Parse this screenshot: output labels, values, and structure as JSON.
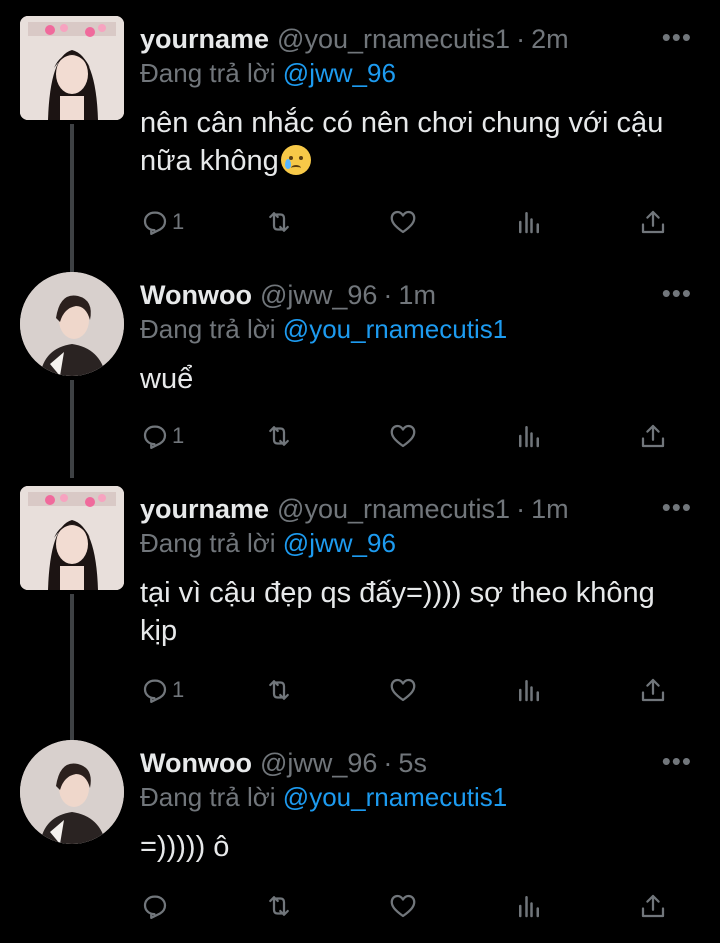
{
  "tweets": [
    {
      "name": "yourname",
      "handle": "@you_rnamecutis1",
      "time": "2m",
      "replying_label": "Đang trả lời",
      "replying_to": "@jww_96",
      "text": "nên cân nhắc có nên chơi chung với cậu nữa không",
      "emoji": "crying-face",
      "reply_count": "1"
    },
    {
      "name": "Wonwoo",
      "handle": "@jww_96",
      "time": "1m",
      "replying_label": "Đang trả lời",
      "replying_to": "@you_rnamecutis1",
      "text": "wuể",
      "reply_count": "1"
    },
    {
      "name": "yourname",
      "handle": "@you_rnamecutis1",
      "time": "1m",
      "replying_label": "Đang trả lời",
      "replying_to": "@jww_96",
      "text": "tại vì cậu đẹp qs đấy=)))) sợ theo không kịp",
      "reply_count": "1"
    },
    {
      "name": "Wonwoo",
      "handle": "@jww_96",
      "time": "5s",
      "replying_label": "Đang trả lời",
      "replying_to": "@you_rnamecutis1",
      "text": "=))))) ô",
      "reply_count": ""
    }
  ],
  "separator": "·",
  "more_label": "•••",
  "icons": [
    "reply-icon",
    "retweet-icon",
    "like-icon",
    "views-icon",
    "share-icon"
  ],
  "colors": {
    "background": "#000000",
    "link": "#1d9bf0",
    "muted": "#71767b",
    "text": "#e7e9ea"
  }
}
